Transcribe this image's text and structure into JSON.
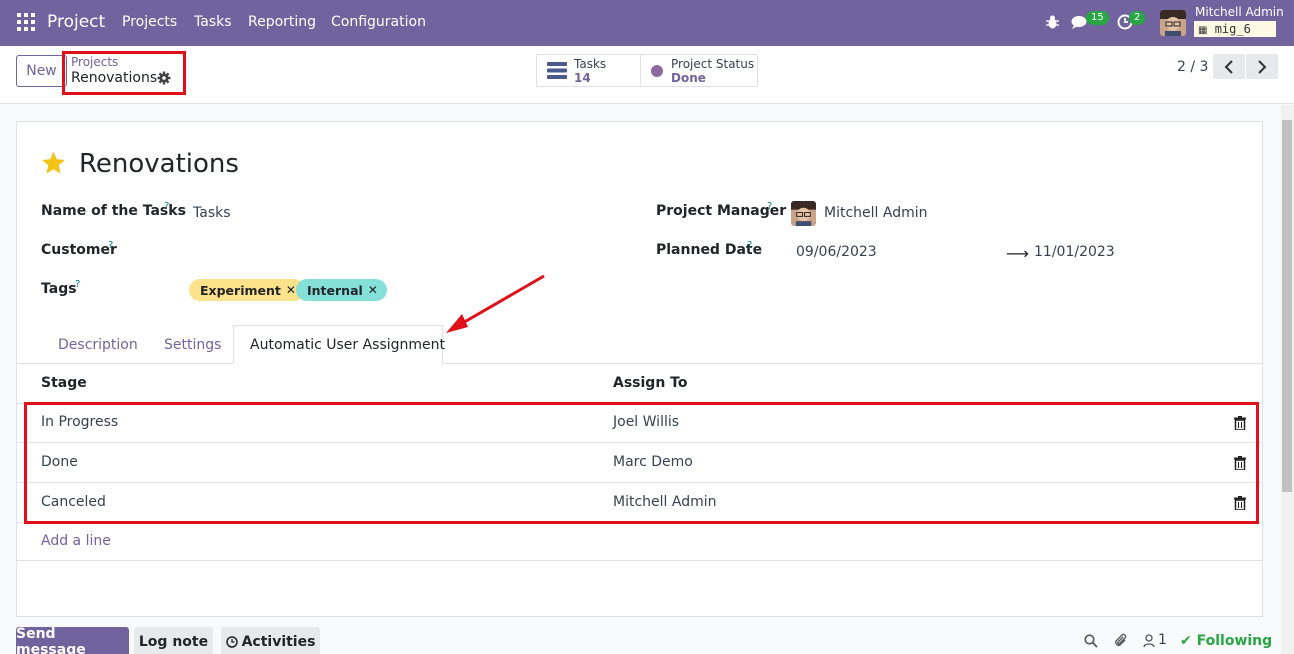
{
  "navbar": {
    "brand": "Project",
    "menu": [
      "Projects",
      "Tasks",
      "Reporting",
      "Configuration"
    ],
    "messages_count": "15",
    "activities_count": "2",
    "user_name": "Mitchell Admin",
    "database": "mig_6"
  },
  "control": {
    "new_label": "New",
    "breadcrumb_parent": "Projects",
    "breadcrumb_current": "Renovations",
    "smart_buttons": {
      "tasks_label": "Tasks",
      "tasks_value": "14",
      "status_label": "Project Status",
      "status_value": "Done"
    },
    "pager": "2 / 3"
  },
  "form": {
    "title": "Renovations",
    "fields": {
      "tasks_name_label": "Name of the Tasks",
      "tasks_name_value": "Tasks",
      "customer_label": "Customer",
      "tags_label": "Tags",
      "manager_label": "Project Manager",
      "manager_value": "Mitchell Admin",
      "planned_label": "Planned Date",
      "planned_start": "09/06/2023",
      "planned_end": "11/01/2023",
      "help_mark": "?"
    },
    "tags": [
      {
        "label": "Experiment",
        "color": "#fce28a"
      },
      {
        "label": "Internal",
        "color": "#84e0d9"
      }
    ],
    "tabs": [
      "Description",
      "Settings",
      "Automatic User Assignment"
    ],
    "table": {
      "headers": [
        "Stage",
        "Assign To"
      ],
      "rows": [
        {
          "stage": "In Progress",
          "assignee": "Joel Willis"
        },
        {
          "stage": "Done",
          "assignee": "Marc Demo"
        },
        {
          "stage": "Canceled",
          "assignee": "Mitchell Admin"
        }
      ],
      "add_line": "Add a line"
    }
  },
  "chatter": {
    "send_message": "Send message",
    "log_note": "Log note",
    "activities": "Activities",
    "followers_count": "1",
    "following": "Following"
  },
  "colors": {
    "primary": "#71639e",
    "annotation": "#e0101a",
    "success": "#28a745"
  }
}
